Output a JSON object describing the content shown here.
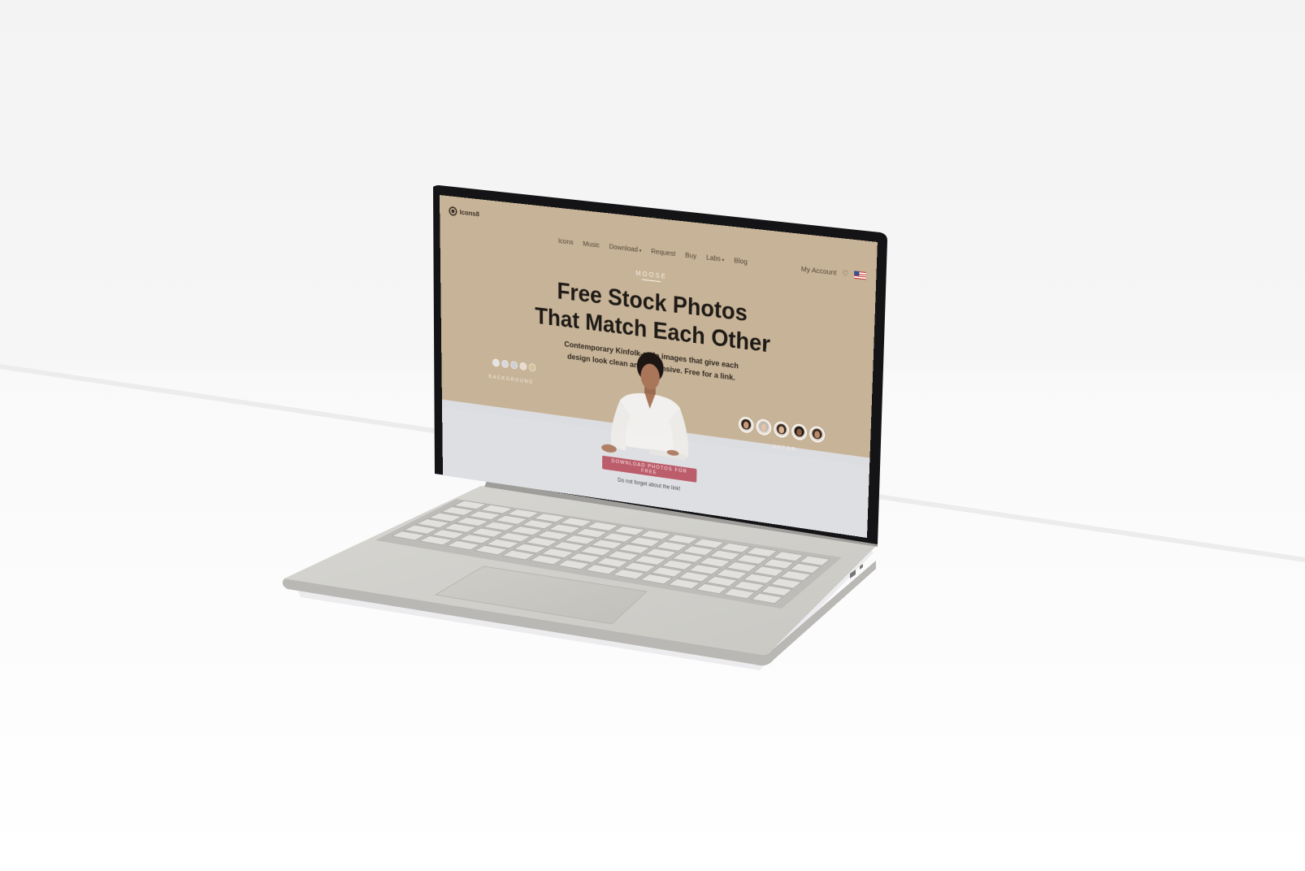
{
  "site": {
    "logo": "Icons8",
    "nav": {
      "items": [
        {
          "label": "Icons",
          "chevron": false
        },
        {
          "label": "Music",
          "chevron": false
        },
        {
          "label": "Download",
          "chevron": true
        },
        {
          "label": "Request",
          "chevron": false
        },
        {
          "label": "Buy",
          "chevron": false
        },
        {
          "label": "Labs",
          "chevron": true
        },
        {
          "label": "Blog",
          "chevron": false
        }
      ],
      "account_label": "My Account"
    },
    "hero": {
      "eyebrow": "MOOSE",
      "title_line1": "Free Stock Photos",
      "title_line2": "That Match Each Other",
      "subtitle": "Contemporary Kinfolk-style images that give each design look clean and expensive. Free for a link."
    },
    "background_picker": {
      "label": "BACKGROUND",
      "swatches": [
        "#e4e4e6",
        "#d8d8dc",
        "#cfcfd3",
        "#e6dbcc",
        "#d6c29d"
      ]
    },
    "actor_picker": {
      "label": "ACTOR",
      "actors": [
        {
          "hair": "#2a1e17",
          "skin": "#c79a7c"
        },
        {
          "hair": "#bfb8b0",
          "skin": "#e2c3ab"
        },
        {
          "hair": "#3a2a20",
          "skin": "#d8b293"
        },
        {
          "hair": "#1c1613",
          "skin": "#8e5f45"
        },
        {
          "hair": "#3b2a1f",
          "skin": "#b9896a"
        }
      ]
    },
    "cta": {
      "button_label": "DOWNLOAD PHOTOS FOR FREE",
      "note": "Do not forget about the link!"
    },
    "colors": {
      "page_background": "#c7b397",
      "desk": "#dcdde1",
      "cta": "#b7505f"
    }
  }
}
